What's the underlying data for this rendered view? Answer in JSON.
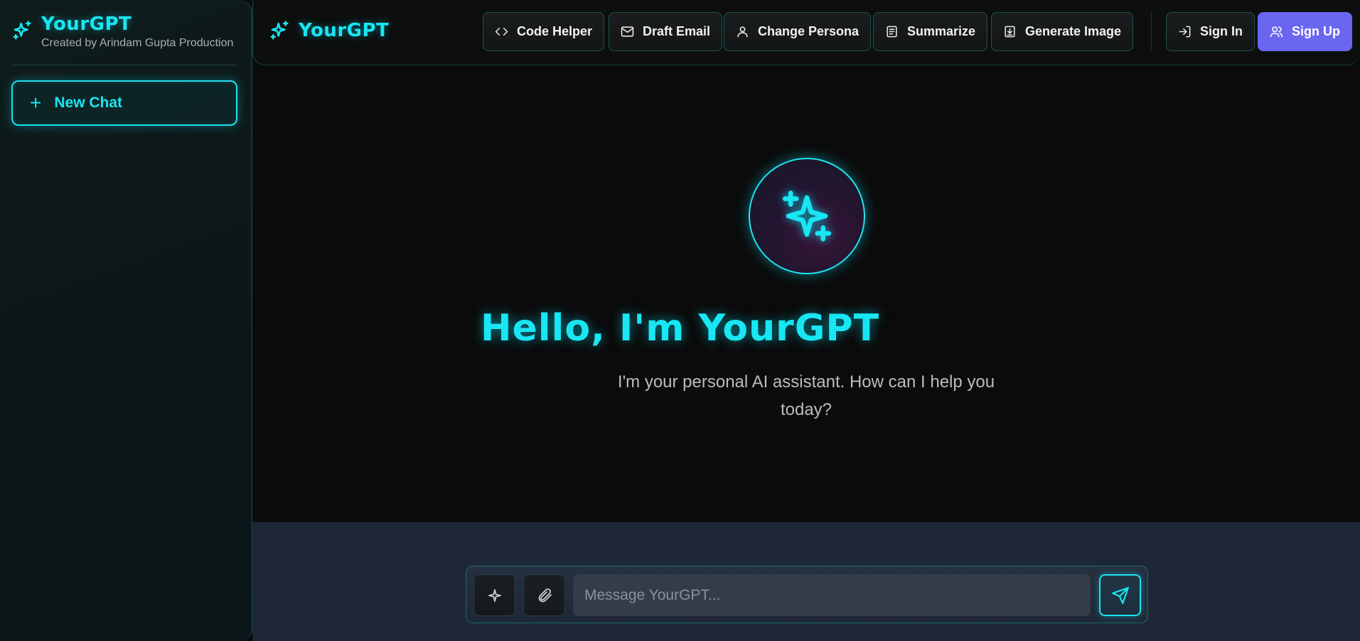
{
  "sidebar": {
    "brand_title": "YourGPT",
    "brand_subtitle": "Created by Arindam Gupta Production",
    "new_chat_label": "New Chat"
  },
  "topbar": {
    "brand_title": "YourGPT",
    "actions": [
      {
        "label": "Code Helper",
        "icon": "code-icon"
      },
      {
        "label": "Draft Email",
        "icon": "mail-icon"
      },
      {
        "label": "Change Persona",
        "icon": "user-icon"
      },
      {
        "label": "Summarize",
        "icon": "document-icon"
      },
      {
        "label": "Generate Image",
        "icon": "download-icon"
      }
    ],
    "sign_in_label": "Sign In",
    "sign_up_label": "Sign Up"
  },
  "hero": {
    "title": "Hello, I'm YourGPT",
    "subtitle": "I'm your personal AI assistant. How can I help you today?"
  },
  "composer": {
    "placeholder": "Message YourGPT..."
  },
  "colors": {
    "accent": "#19e6f3",
    "signup": "#6b66f0",
    "background": "#0b0b0b"
  }
}
